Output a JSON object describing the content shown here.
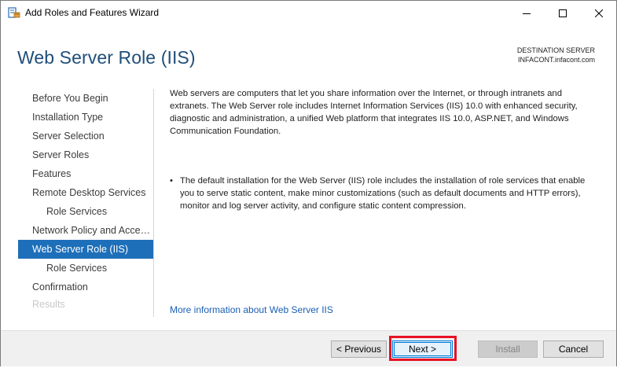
{
  "window": {
    "title": "Add Roles and Features Wizard",
    "icons": {
      "app": "server-manager-icon",
      "minimize": "minimize-icon",
      "maximize": "maximize-icon",
      "close": "close-icon"
    }
  },
  "header": {
    "page_title": "Web Server Role (IIS)",
    "destination_label": "DESTINATION SERVER",
    "destination_value": "INFACONT.infacont.com"
  },
  "nav": {
    "items": [
      {
        "label": "Before You Begin"
      },
      {
        "label": "Installation Type"
      },
      {
        "label": "Server Selection"
      },
      {
        "label": "Server Roles"
      },
      {
        "label": "Features"
      },
      {
        "label": "Remote Desktop Services"
      },
      {
        "label": "Role Services"
      },
      {
        "label": "Network Policy and Acces..."
      },
      {
        "label": "Web Server Role (IIS)"
      },
      {
        "label": "Role Services"
      },
      {
        "label": "Confirmation"
      },
      {
        "label": "Results"
      }
    ],
    "selected_index": 8
  },
  "content": {
    "intro": "Web servers are computers that let you share information over the Internet, or through intranets and extranets. The Web Server role includes Internet Information Services (IIS) 10.0 with enhanced security, diagnostic and administration, a unified Web platform that integrates IIS 10.0, ASP.NET, and Windows Communication Foundation.",
    "bullet": "The default installation for the Web Server (IIS) role includes the installation of role services that enable you to serve static content, make minor customizations (such as default documents and HTTP errors), monitor and log server activity, and configure static content compression.",
    "bullet_char": "•",
    "more_info_link": "More information about Web Server IIS"
  },
  "footer": {
    "previous_label": "< Previous",
    "next_label": "Next >",
    "install_label": "Install",
    "cancel_label": "Cancel"
  },
  "colors": {
    "title_blue": "#1f4e79",
    "selected_nav": "#1e6fb9",
    "link_blue": "#1a5fb4",
    "highlight_red": "#e81123"
  }
}
